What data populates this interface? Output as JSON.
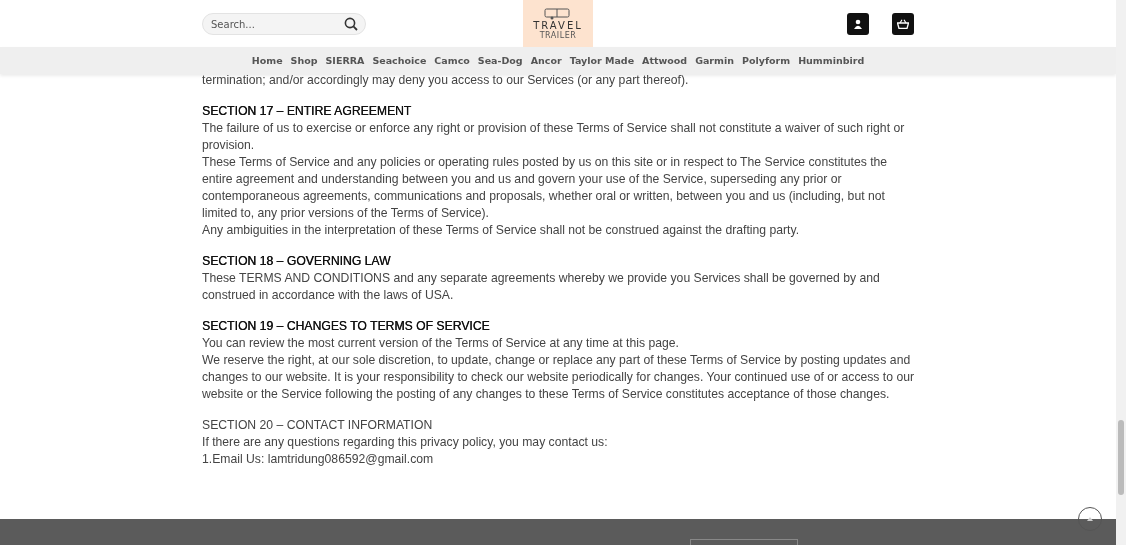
{
  "header": {
    "search": {
      "placeholder": "Search..."
    },
    "logo": {
      "title": "TRAVEL",
      "subtitle": "TRAILER"
    }
  },
  "nav": {
    "items": [
      "Home",
      "Shop",
      "SIERRA",
      "Seachoice",
      "Camco",
      "Sea-Dog",
      "Ancor",
      "Taylor Made",
      "Attwood",
      "Garmin",
      "Polyform",
      "Humminbird"
    ]
  },
  "content": {
    "lead": "termination; and/or accordingly may deny you access to our Services (or any part thereof).",
    "sections": [
      {
        "title": "SECTION 17 – ENTIRE AGREEMENT",
        "emphasis": true,
        "paragraphs": [
          "The failure of us to exercise or enforce any right or provision of these Terms of Service shall not constitute a waiver of such right or provision.",
          "These Terms of Service and any policies or operating rules posted by us on this site or in respect to The Service constitutes the entire agreement and understanding between you and us and govern your use of the Service, superseding any prior or contemporaneous agreements, communications and proposals, whether oral or written, between you and us (including, but not limited to, any prior versions of the Terms of Service).",
          "Any ambiguities in the interpretation of these Terms of Service shall not be construed against the drafting party."
        ]
      },
      {
        "title": "SECTION 18 – GOVERNING LAW",
        "emphasis": true,
        "paragraphs": [
          "These TERMS AND CONDITIONS and any separate agreements whereby we provide you Services shall be governed by and construed in accordance with the laws of USA."
        ]
      },
      {
        "title": "SECTION 19 – CHANGES TO TERMS OF SERVICE",
        "emphasis": true,
        "paragraphs": [
          "You can review the most current version of the Terms of Service at any time at this page.",
          "We reserve the right, at our sole discretion, to update, change or replace any part of these Terms of Service by posting updates and changes to our website. It is your responsibility to check our website periodically for changes. Your continued use of or access to our website or the Service following the posting of any changes to these Terms of Service constitutes acceptance of those changes."
        ]
      },
      {
        "title": "SECTION 20 – CONTACT INFORMATION",
        "emphasis": false,
        "paragraphs": [
          "If there are any questions regarding this privacy policy, you may contact us:",
          "1.Email Us: lamtridung086592@gmail.com"
        ]
      }
    ]
  }
}
